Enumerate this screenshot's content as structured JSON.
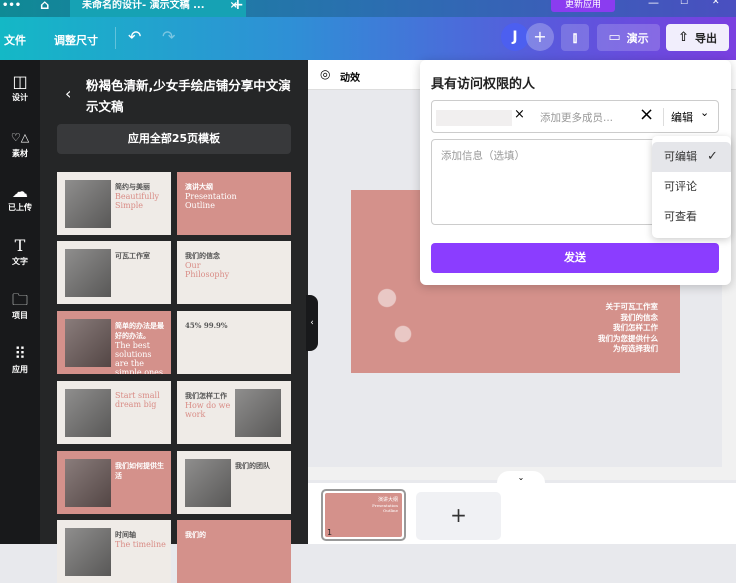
{
  "tabbar": {
    "menu_icon": "ellipsis-icon",
    "home_icon": "home-icon",
    "tab_title": "未命名的设计- 演示文稿 ...",
    "close": "×",
    "new_tab": "+",
    "update_button": "更新应用",
    "window_controls": [
      "—",
      "☐",
      "✕"
    ]
  },
  "toolbar": {
    "file": "文件",
    "resize": "调整尺寸",
    "undo_icon": "undo-icon",
    "redo_icon": "redo-icon",
    "avatar": "J",
    "add": "+",
    "present": "演示",
    "export": "导出"
  },
  "rail": [
    {
      "icon": "layout-icon",
      "glyph": "◫",
      "label": "设计"
    },
    {
      "icon": "elements-icon",
      "glyph": "♡△",
      "label": "素材"
    },
    {
      "icon": "upload-icon",
      "glyph": "☁",
      "label": "已上传"
    },
    {
      "icon": "text-icon",
      "glyph": "T",
      "label": "文字"
    },
    {
      "icon": "folder-icon",
      "glyph": "🗀",
      "label": "项目"
    },
    {
      "icon": "apps-icon",
      "glyph": "⠿",
      "label": "应用"
    }
  ],
  "panel": {
    "title": "粉褐色清新,少女手绘店铺分享中文演示文稿",
    "apply_all": "应用全部25页模板",
    "thumbs": [
      {
        "style": "cream",
        "l1": "简约与美丽",
        "l2": "Beautifully Simple"
      },
      {
        "style": "pink",
        "l1": "演讲大纲",
        "l2": "Presentation Outline"
      },
      {
        "style": "cream",
        "l1": "可瓦工作室",
        "l2": ""
      },
      {
        "style": "cream",
        "l1": "我们的信念",
        "l2": "Our Philosophy"
      },
      {
        "style": "pink",
        "l1": "简单的办法是最好的办法。",
        "l2": "The best solutions are the simple ones."
      },
      {
        "style": "cream",
        "l1": "45%        99.9%",
        "l2": ""
      },
      {
        "style": "cream",
        "l1": "",
        "l2": "Start small dream big"
      },
      {
        "style": "cream",
        "l1": "我们怎样工作",
        "l2": "How do we work"
      },
      {
        "style": "pink",
        "l1": "我们如何提供生活",
        "l2": ""
      },
      {
        "style": "cream",
        "l1": "我们的团队",
        "l2": ""
      },
      {
        "style": "cream",
        "l1": "时间轴",
        "l2": "The timeline"
      },
      {
        "style": "pink",
        "l1": "我们的",
        "l2": ""
      }
    ]
  },
  "canvas": {
    "animate": "动效",
    "slide_lines": [
      "关于可瓦工作室",
      "我们的信念",
      "我们怎样工作",
      "我们为您提供什么",
      "为何选择我们"
    ]
  },
  "share": {
    "title": "具有访问权限的人",
    "member_placeholder": "添加更多成员...",
    "permission": "编辑",
    "message_placeholder": "添加信息（选填）",
    "send": "发送",
    "options": [
      {
        "label": "可编辑",
        "selected": true
      },
      {
        "label": "可评论",
        "selected": false
      },
      {
        "label": "可查看",
        "selected": false
      }
    ]
  },
  "pages": {
    "page_number": "1",
    "thumb_title": "演讲大纲",
    "thumb_sub": "Presentation Outline",
    "add": "+"
  }
}
